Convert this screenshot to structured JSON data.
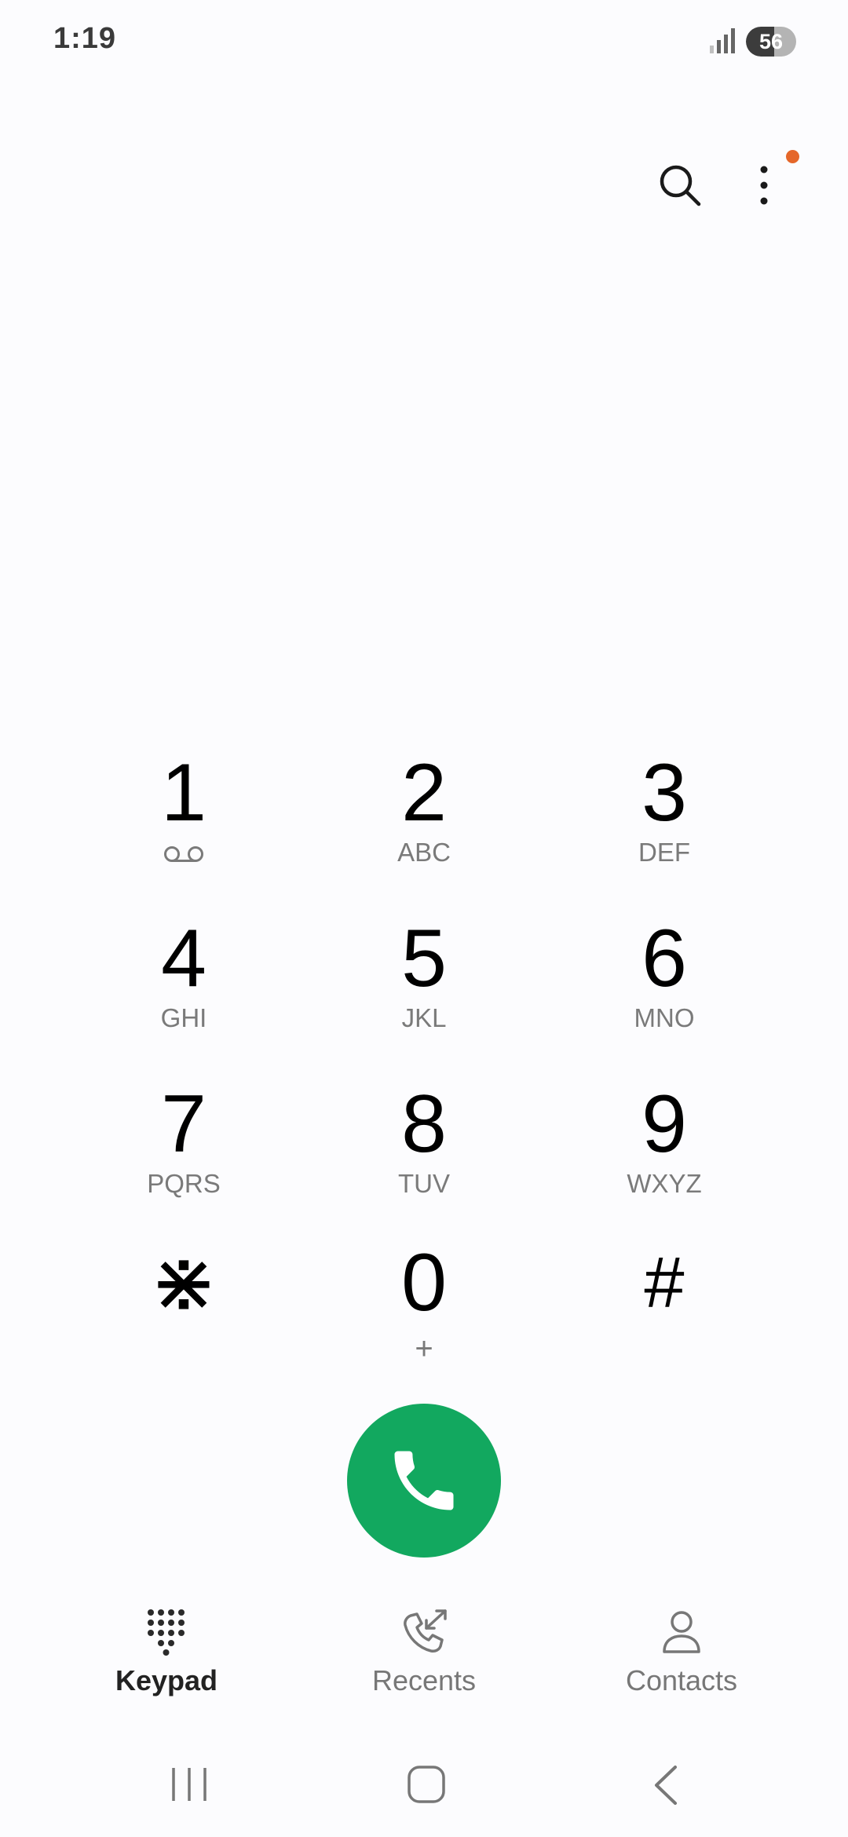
{
  "status_bar": {
    "time": "1:19",
    "battery_level": "56",
    "battery_fraction": 0.56
  },
  "top_actions": {
    "search_icon": "search-icon",
    "more_icon": "more-options-icon",
    "notification_dot_color": "#e5672a"
  },
  "keypad": {
    "keys": [
      {
        "digit": "1",
        "sub": "",
        "sub_icon": "voicemail-icon"
      },
      {
        "digit": "2",
        "sub": "ABC"
      },
      {
        "digit": "3",
        "sub": "DEF"
      },
      {
        "digit": "4",
        "sub": "GHI"
      },
      {
        "digit": "5",
        "sub": "JKL"
      },
      {
        "digit": "6",
        "sub": "MNO"
      },
      {
        "digit": "7",
        "sub": "PQRS"
      },
      {
        "digit": "8",
        "sub": "TUV"
      },
      {
        "digit": "9",
        "sub": "WXYZ"
      },
      {
        "digit": "⋇",
        "sub": ""
      },
      {
        "digit": "0",
        "sub": "+"
      },
      {
        "digit": "#",
        "sub": ""
      }
    ]
  },
  "call_button": {
    "icon": "phone-icon",
    "color": "#12a85f"
  },
  "tabs": [
    {
      "label": "Keypad",
      "icon": "keypad-icon",
      "active": true
    },
    {
      "label": "Recents",
      "icon": "recents-icon",
      "active": false
    },
    {
      "label": "Contacts",
      "icon": "contacts-icon",
      "active": false
    }
  ],
  "nav_bar": {
    "recent_apps_icon": "recent-apps-icon",
    "home_icon": "home-icon",
    "back_icon": "back-icon"
  }
}
